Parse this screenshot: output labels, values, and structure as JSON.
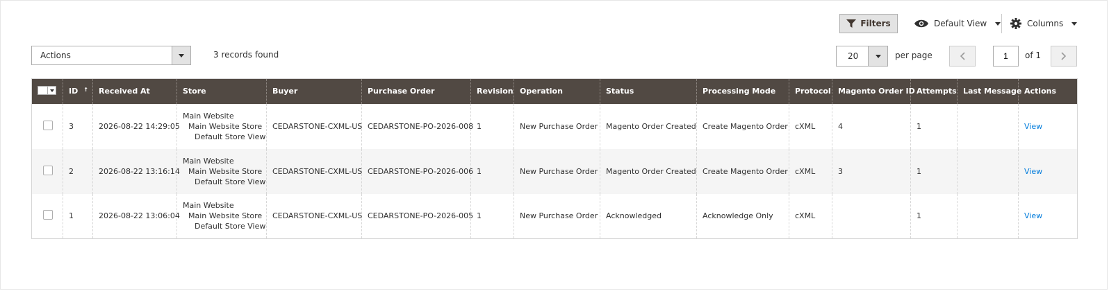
{
  "toolbar": {
    "filters_label": "Filters",
    "view_label": "Default View",
    "columns_label": "Columns"
  },
  "actions": {
    "select_label": "Actions",
    "records_found": "3 records found"
  },
  "pagination": {
    "per_page_value": "20",
    "per_page_label": "per page",
    "current_page": "1",
    "of_label": "of 1"
  },
  "grid": {
    "columns": [
      "ID",
      "Received At",
      "Store",
      "Buyer",
      "Purchase Order",
      "Revision",
      "Operation",
      "Status",
      "Processing Mode",
      "Protocol",
      "Magento Order ID",
      "Attempts",
      "Last Message",
      "Actions"
    ],
    "sort_indicator": "↑",
    "rows": [
      {
        "id": "3",
        "received_at": "2026-08-22 14:29:05",
        "store": [
          "Main Website",
          "Main Website Store",
          "Default Store View"
        ],
        "buyer": "CEDARSTONE-CXML-US",
        "purchase_order": "CEDARSTONE-PO-2026-008",
        "revision": "1",
        "operation": "New Purchase Order",
        "status": "Magento Order Created",
        "processing_mode": "Create Magento Order",
        "protocol": "cXML",
        "magento_order_id": "4",
        "attempts": "1",
        "last_message": "",
        "action": "View"
      },
      {
        "id": "2",
        "received_at": "2026-08-22 13:16:14",
        "store": [
          "Main Website",
          "Main Website Store",
          "Default Store View"
        ],
        "buyer": "CEDARSTONE-CXML-US",
        "purchase_order": "CEDARSTONE-PO-2026-006",
        "revision": "1",
        "operation": "New Purchase Order",
        "status": "Magento Order Created",
        "processing_mode": "Create Magento Order",
        "protocol": "cXML",
        "magento_order_id": "3",
        "attempts": "1",
        "last_message": "",
        "action": "View"
      },
      {
        "id": "1",
        "received_at": "2026-08-22 13:06:04",
        "store": [
          "Main Website",
          "Main Website Store",
          "Default Store View"
        ],
        "buyer": "CEDARSTONE-CXML-US",
        "purchase_order": "CEDARSTONE-PO-2026-005",
        "revision": "1",
        "operation": "New Purchase Order",
        "status": "Acknowledged",
        "processing_mode": "Acknowledge Only",
        "protocol": "cXML",
        "magento_order_id": "",
        "attempts": "1",
        "last_message": "",
        "action": "View"
      }
    ]
  },
  "icons": {
    "filters": "funnel-icon",
    "view": "eye-icon",
    "columns": "gear-icon",
    "prev": "chevron-left-icon",
    "next": "chevron-right-icon"
  },
  "colors": {
    "header_bg": "#514943",
    "link": "#007bdb",
    "button_bg": "#e3e3e3"
  }
}
